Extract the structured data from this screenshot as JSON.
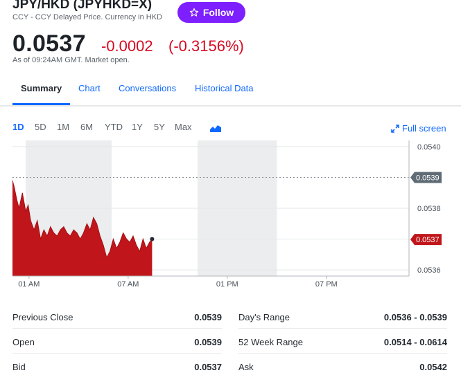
{
  "header": {
    "title": "JPY/HKD (JPYHKD=X)",
    "subtitle": "CCY - CCY Delayed Price. Currency in HKD",
    "follow_label": "Follow"
  },
  "quote": {
    "price": "0.0537",
    "change": "-0.0002",
    "change_pct": "(-0.3156%)",
    "as_of": "As of 09:24AM GMT. Market open."
  },
  "tabs": [
    {
      "label": "Summary",
      "active": true
    },
    {
      "label": "Chart"
    },
    {
      "label": "Conversations"
    },
    {
      "label": "Historical Data"
    }
  ],
  "range_buttons": [
    "1D",
    "5D",
    "1M",
    "6M",
    "YTD",
    "1Y",
    "5Y",
    "Max"
  ],
  "active_range": "1D",
  "full_screen_label": "Full screen",
  "colors": {
    "accent": "#0f69ff",
    "follow": "#7e1fff",
    "negative": "#d60a22",
    "area_fill": "#c0161b",
    "prev_close_tag": "#5f6b75"
  },
  "chart_data": {
    "type": "area",
    "x_ticks": [
      "01 AM",
      "07 AM",
      "01 PM",
      "07 PM"
    ],
    "y_ticks": [
      "0.0540",
      "0.0539",
      "0.0538",
      "0.0537",
      "0.0536"
    ],
    "y_tick_values": [
      0.054,
      0.0538,
      0.0537,
      0.0536
    ],
    "ylim": [
      0.05358,
      0.05402
    ],
    "xlim_hours": [
      0,
      24
    ],
    "previous_close": 0.0539,
    "previous_close_label": "0.0539",
    "current_label": "0.0537",
    "x_hours": [
      0.0,
      0.1,
      0.25,
      0.4,
      0.6,
      0.8,
      0.95,
      1.1,
      1.3,
      1.5,
      1.7,
      1.9,
      2.1,
      2.3,
      2.5,
      2.7,
      2.9,
      3.1,
      3.3,
      3.5,
      3.7,
      3.9,
      4.1,
      4.3,
      4.5,
      4.7,
      4.9,
      5.1,
      5.3,
      5.5,
      5.7,
      5.9,
      6.1,
      6.3,
      6.5,
      6.7,
      6.9,
      7.1,
      7.3,
      7.5,
      7.7,
      7.9,
      8.1,
      8.3,
      8.45
    ],
    "y_values": [
      0.05389,
      0.05387,
      0.05383,
      0.0538,
      0.05385,
      0.05379,
      0.05381,
      0.05376,
      0.05373,
      0.05376,
      0.0537,
      0.05373,
      0.05371,
      0.05374,
      0.05372,
      0.05371,
      0.05373,
      0.05374,
      0.05372,
      0.05371,
      0.05373,
      0.05372,
      0.0537,
      0.05372,
      0.05375,
      0.05373,
      0.05377,
      0.05375,
      0.05371,
      0.05368,
      0.05364,
      0.05366,
      0.0537,
      0.05367,
      0.05369,
      0.05372,
      0.0537,
      0.05369,
      0.05371,
      0.05368,
      0.05366,
      0.0537,
      0.05367,
      0.05369,
      0.0537
    ],
    "gray_bands_hours": [
      [
        0.8,
        6.0
      ],
      [
        11.2,
        16.0
      ]
    ]
  },
  "stats": [
    {
      "label": "Previous Close",
      "value": "0.0539",
      "label2": "Day's Range",
      "value2": "0.0536 - 0.0539"
    },
    {
      "label": "Open",
      "value": "0.0539",
      "label2": "52 Week Range",
      "value2": "0.0514 - 0.0614"
    },
    {
      "label": "Bid",
      "value": "0.0537",
      "label2": "Ask",
      "value2": "0.0542"
    }
  ]
}
